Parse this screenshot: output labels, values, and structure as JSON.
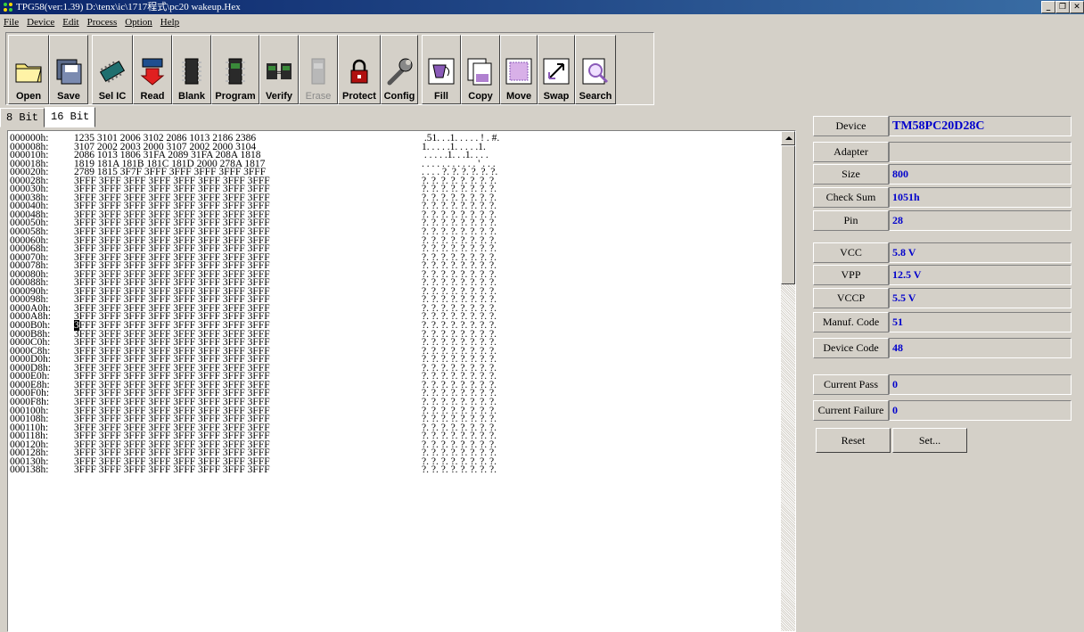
{
  "window": {
    "title": "TPG58(ver:1.39) D:\\tenx\\ic\\1717程式\\pc20 wakeup.Hex",
    "controls": [
      "_",
      "❐",
      "✕"
    ]
  },
  "menu": [
    "File",
    "Device",
    "Edit",
    "Process",
    "Option",
    "Help"
  ],
  "toolbar": [
    {
      "label": "Open",
      "icon": "folder-icon"
    },
    {
      "label": "Save",
      "icon": "save-icon"
    },
    {
      "label": "Sel IC",
      "icon": "chip-icon"
    },
    {
      "label": "Read",
      "icon": "read-icon"
    },
    {
      "label": "Blank",
      "icon": "blank-icon"
    },
    {
      "label": "Program",
      "icon": "program-icon"
    },
    {
      "label": "Verify",
      "icon": "verify-icon"
    },
    {
      "label": "Erase",
      "icon": "erase-icon",
      "disabled": true
    },
    {
      "label": "Protect",
      "icon": "lock-icon"
    },
    {
      "label": "Config",
      "icon": "wrench-icon"
    },
    {
      "label": "Fill",
      "icon": "fill-icon"
    },
    {
      "label": "Copy",
      "icon": "copy-icon"
    },
    {
      "label": "Move",
      "icon": "move-icon"
    },
    {
      "label": "Swap",
      "icon": "swap-icon"
    },
    {
      "label": "Search",
      "icon": "search-icon"
    }
  ],
  "tabs": [
    {
      "label": "8 Bit",
      "active": false
    },
    {
      "label": "16 Bit",
      "active": true
    }
  ],
  "hex": {
    "cursor": {
      "row": 22,
      "word": 0,
      "char": 0
    },
    "rows": [
      {
        "addr": "000000h:",
        "words": "1235 3101 2006 3102 2086 1013 2186 2386",
        "ascii": " .51. . .1. . . . . ! . #."
      },
      {
        "addr": "000008h:",
        "words": "3107 2002 2003 2000 3107 2002 2000 3104",
        "ascii": "1. . . . .1. . . . .1."
      },
      {
        "addr": "000010h:",
        "words": "2086 1013 1806 31FA 2089 31FA 208A 1818",
        "ascii": " . . . . .1. . .1. . . ."
      },
      {
        "addr": "000018h:",
        "words": "1819 181A 181B 181C 181D 2000 278A 1817",
        "ascii": ". . . . . . . . . . . ' . . ."
      },
      {
        "addr": "000020h:",
        "words": "2789 1815 3F7F 3FFF 3FFF 3FFF 3FFF 3FFF",
        "ascii": ". . . . ?. ?. ?. ?. ?. ?."
      },
      {
        "addr": "000028h:",
        "words": "3FFF 3FFF 3FFF 3FFF 3FFF 3FFF 3FFF 3FFF",
        "ascii": "?. ?. ?. ?. ?. ?. ?. ?."
      },
      {
        "addr": "000030h:",
        "words": "3FFF 3FFF 3FFF 3FFF 3FFF 3FFF 3FFF 3FFF",
        "ascii": "?. ?. ?. ?. ?. ?. ?. ?."
      },
      {
        "addr": "000038h:",
        "words": "3FFF 3FFF 3FFF 3FFF 3FFF 3FFF 3FFF 3FFF",
        "ascii": "?. ?. ?. ?. ?. ?. ?. ?."
      },
      {
        "addr": "000040h:",
        "words": "3FFF 3FFF 3FFF 3FFF 3FFF 3FFF 3FFF 3FFF",
        "ascii": "?. ?. ?. ?. ?. ?. ?. ?."
      },
      {
        "addr": "000048h:",
        "words": "3FFF 3FFF 3FFF 3FFF 3FFF 3FFF 3FFF 3FFF",
        "ascii": "?. ?. ?. ?. ?. ?. ?. ?."
      },
      {
        "addr": "000050h:",
        "words": "3FFF 3FFF 3FFF 3FFF 3FFF 3FFF 3FFF 3FFF",
        "ascii": "?. ?. ?. ?. ?. ?. ?. ?."
      },
      {
        "addr": "000058h:",
        "words": "3FFF 3FFF 3FFF 3FFF 3FFF 3FFF 3FFF 3FFF",
        "ascii": "?. ?. ?. ?. ?. ?. ?. ?."
      },
      {
        "addr": "000060h:",
        "words": "3FFF 3FFF 3FFF 3FFF 3FFF 3FFF 3FFF 3FFF",
        "ascii": "?. ?. ?. ?. ?. ?. ?. ?."
      },
      {
        "addr": "000068h:",
        "words": "3FFF 3FFF 3FFF 3FFF 3FFF 3FFF 3FFF 3FFF",
        "ascii": "?. ?. ?. ?. ?. ?. ?. ?."
      },
      {
        "addr": "000070h:",
        "words": "3FFF 3FFF 3FFF 3FFF 3FFF 3FFF 3FFF 3FFF",
        "ascii": "?. ?. ?. ?. ?. ?. ?. ?."
      },
      {
        "addr": "000078h:",
        "words": "3FFF 3FFF 3FFF 3FFF 3FFF 3FFF 3FFF 3FFF",
        "ascii": "?. ?. ?. ?. ?. ?. ?. ?."
      },
      {
        "addr": "000080h:",
        "words": "3FFF 3FFF 3FFF 3FFF 3FFF 3FFF 3FFF 3FFF",
        "ascii": "?. ?. ?. ?. ?. ?. ?. ?."
      },
      {
        "addr": "000088h:",
        "words": "3FFF 3FFF 3FFF 3FFF 3FFF 3FFF 3FFF 3FFF",
        "ascii": "?. ?. ?. ?. ?. ?. ?. ?."
      },
      {
        "addr": "000090h:",
        "words": "3FFF 3FFF 3FFF 3FFF 3FFF 3FFF 3FFF 3FFF",
        "ascii": "?. ?. ?. ?. ?. ?. ?. ?."
      },
      {
        "addr": "000098h:",
        "words": "3FFF 3FFF 3FFF 3FFF 3FFF 3FFF 3FFF 3FFF",
        "ascii": "?. ?. ?. ?. ?. ?. ?. ?."
      },
      {
        "addr": "0000A0h:",
        "words": "3FFF 3FFF 3FFF 3FFF 3FFF 3FFF 3FFF 3FFF",
        "ascii": "?. ?. ?. ?. ?. ?. ?. ?."
      },
      {
        "addr": "0000A8h:",
        "words": "3FFF 3FFF 3FFF 3FFF 3FFF 3FFF 3FFF 3FFF",
        "ascii": "?. ?. ?. ?. ?. ?. ?. ?."
      },
      {
        "addr": "0000B0h:",
        "words": "3FFF 3FFF 3FFF 3FFF 3FFF 3FFF 3FFF 3FFF",
        "ascii": "?. ?. ?. ?. ?. ?. ?. ?."
      },
      {
        "addr": "0000B8h:",
        "words": "3FFF 3FFF 3FFF 3FFF 3FFF 3FFF 3FFF 3FFF",
        "ascii": "?. ?. ?. ?. ?. ?. ?. ?."
      },
      {
        "addr": "0000C0h:",
        "words": "3FFF 3FFF 3FFF 3FFF 3FFF 3FFF 3FFF 3FFF",
        "ascii": "?. ?. ?. ?. ?. ?. ?. ?."
      },
      {
        "addr": "0000C8h:",
        "words": "3FFF 3FFF 3FFF 3FFF 3FFF 3FFF 3FFF 3FFF",
        "ascii": "?. ?. ?. ?. ?. ?. ?. ?."
      },
      {
        "addr": "0000D0h:",
        "words": "3FFF 3FFF 3FFF 3FFF 3FFF 3FFF 3FFF 3FFF",
        "ascii": "?. ?. ?. ?. ?. ?. ?. ?."
      },
      {
        "addr": "0000D8h:",
        "words": "3FFF 3FFF 3FFF 3FFF 3FFF 3FFF 3FFF 3FFF",
        "ascii": "?. ?. ?. ?. ?. ?. ?. ?."
      },
      {
        "addr": "0000E0h:",
        "words": "3FFF 3FFF 3FFF 3FFF 3FFF 3FFF 3FFF 3FFF",
        "ascii": "?. ?. ?. ?. ?. ?. ?. ?."
      },
      {
        "addr": "0000E8h:",
        "words": "3FFF 3FFF 3FFF 3FFF 3FFF 3FFF 3FFF 3FFF",
        "ascii": "?. ?. ?. ?. ?. ?. ?. ?."
      },
      {
        "addr": "0000F0h:",
        "words": "3FFF 3FFF 3FFF 3FFF 3FFF 3FFF 3FFF 3FFF",
        "ascii": "?. ?. ?. ?. ?. ?. ?. ?."
      },
      {
        "addr": "0000F8h:",
        "words": "3FFF 3FFF 3FFF 3FFF 3FFF 3FFF 3FFF 3FFF",
        "ascii": "?. ?. ?. ?. ?. ?. ?. ?."
      },
      {
        "addr": "000100h:",
        "words": "3FFF 3FFF 3FFF 3FFF 3FFF 3FFF 3FFF 3FFF",
        "ascii": "?. ?. ?. ?. ?. ?. ?. ?."
      },
      {
        "addr": "000108h:",
        "words": "3FFF 3FFF 3FFF 3FFF 3FFF 3FFF 3FFF 3FFF",
        "ascii": "?. ?. ?. ?. ?. ?. ?. ?."
      },
      {
        "addr": "000110h:",
        "words": "3FFF 3FFF 3FFF 3FFF 3FFF 3FFF 3FFF 3FFF",
        "ascii": "?. ?. ?. ?. ?. ?. ?. ?."
      },
      {
        "addr": "000118h:",
        "words": "3FFF 3FFF 3FFF 3FFF 3FFF 3FFF 3FFF 3FFF",
        "ascii": "?. ?. ?. ?. ?. ?. ?. ?."
      },
      {
        "addr": "000120h:",
        "words": "3FFF 3FFF 3FFF 3FFF 3FFF 3FFF 3FFF 3FFF",
        "ascii": "?. ?. ?. ?. ?. ?. ?. ?."
      },
      {
        "addr": "000128h:",
        "words": "3FFF 3FFF 3FFF 3FFF 3FFF 3FFF 3FFF 3FFF",
        "ascii": "?. ?. ?. ?. ?. ?. ?. ?."
      },
      {
        "addr": "000130h:",
        "words": "3FFF 3FFF 3FFF 3FFF 3FFF 3FFF 3FFF 3FFF",
        "ascii": "?. ?. ?. ?. ?. ?. ?. ?."
      },
      {
        "addr": "000138h:",
        "words": "3FFF 3FFF 3FFF 3FFF 3FFF 3FFF 3FFF 3FFF",
        "ascii": "?. ?. ?. ?. ?. ?. ?. ?."
      }
    ]
  },
  "info": {
    "device": {
      "label": "Device",
      "value": "TM58PC20D28C"
    },
    "adapter": {
      "label": "Adapter",
      "value": ""
    },
    "size": {
      "label": "Size",
      "value": "800"
    },
    "checksum": {
      "label": "Check Sum",
      "value": "1051h"
    },
    "pin": {
      "label": "Pin",
      "value": "28"
    },
    "vcc": {
      "label": "VCC",
      "value": "5.8 V"
    },
    "vpp": {
      "label": "VPP",
      "value": "12.5 V"
    },
    "vccp": {
      "label": "VCCP",
      "value": "5.5 V"
    },
    "manuf_code": {
      "label": "Manuf. Code",
      "value": "51"
    },
    "device_code": {
      "label": "Device Code",
      "value": "48"
    },
    "current_pass": {
      "label": "Current Pass",
      "value": "0"
    },
    "current_failure": {
      "label": "Current Failure",
      "value": "0"
    },
    "reset_label": "Reset",
    "set_label": "Set..."
  },
  "colors": {
    "face": "#d4d0c8",
    "title_start": "#0a246a",
    "title_end": "#3a6ea5",
    "value_text": "#0000cc"
  }
}
